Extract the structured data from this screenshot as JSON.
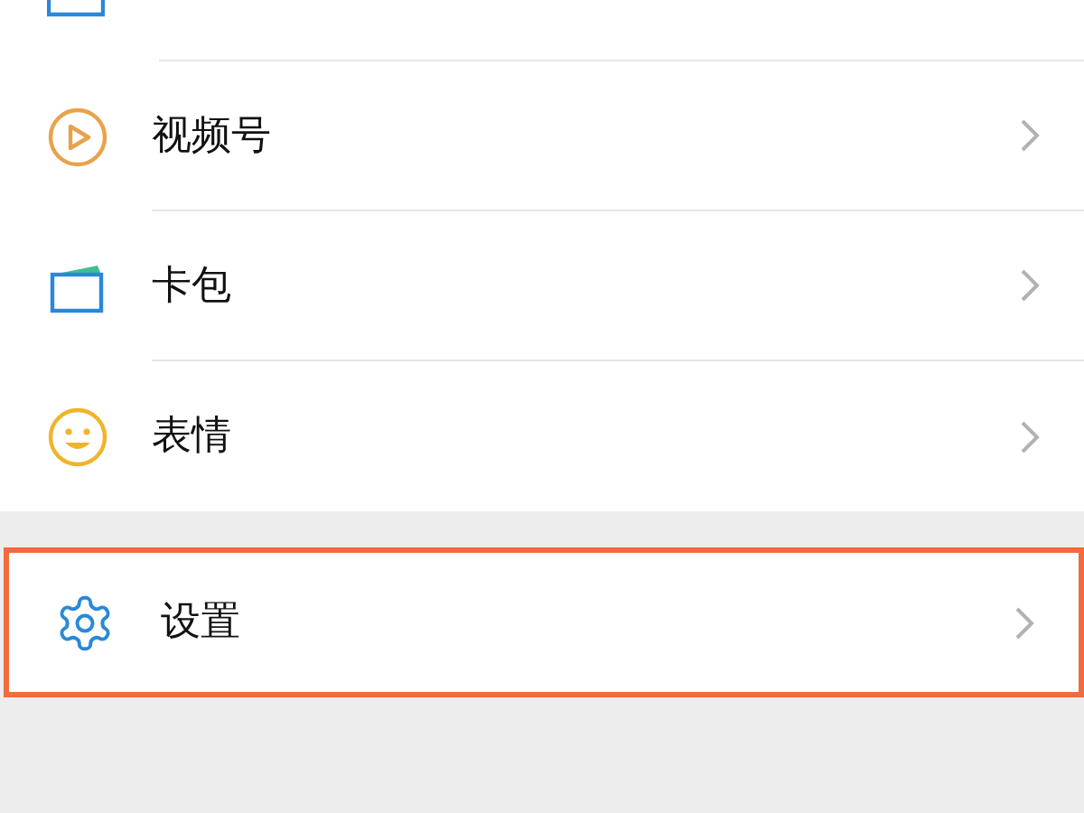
{
  "groups": [
    {
      "items": [
        {
          "kind": "channels",
          "label": "视频号",
          "highlighted": false
        },
        {
          "kind": "wallet",
          "label": "卡包",
          "highlighted": false
        },
        {
          "kind": "sticker",
          "label": "表情",
          "highlighted": false
        }
      ]
    },
    {
      "items": [
        {
          "kind": "settings",
          "label": "设置",
          "highlighted": true
        }
      ]
    }
  ]
}
